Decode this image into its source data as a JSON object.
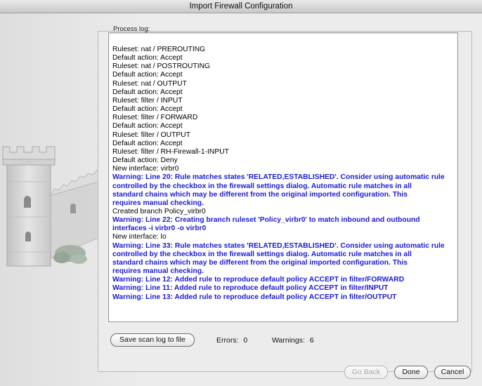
{
  "window": {
    "title": "Import Firewall Configuration"
  },
  "panel": {
    "label": "Process log:"
  },
  "log_lines": [
    {
      "text": "Ruleset: nat / PREROUTING",
      "kind": "normal"
    },
    {
      "text": "Default action: Accept",
      "kind": "normal"
    },
    {
      "text": "Ruleset: nat / POSTROUTING",
      "kind": "normal"
    },
    {
      "text": "Default action: Accept",
      "kind": "normal"
    },
    {
      "text": "Ruleset: nat / OUTPUT",
      "kind": "normal"
    },
    {
      "text": "Default action: Accept",
      "kind": "normal"
    },
    {
      "text": "Ruleset: filter / INPUT",
      "kind": "normal"
    },
    {
      "text": "Default action: Accept",
      "kind": "normal"
    },
    {
      "text": "Ruleset: filter / FORWARD",
      "kind": "normal"
    },
    {
      "text": "Default action: Accept",
      "kind": "normal"
    },
    {
      "text": "Ruleset: filter / OUTPUT",
      "kind": "normal"
    },
    {
      "text": "Default action: Accept",
      "kind": "normal"
    },
    {
      "text": "Ruleset: filter / RH-Firewall-1-INPUT",
      "kind": "normal"
    },
    {
      "text": "Default action: Deny",
      "kind": "normal"
    },
    {
      "text": "New interface: virbr0",
      "kind": "normal"
    },
    {
      "text": "Warning: Line 20: Rule matches states 'RELATED,ESTABLISHED'. Consider using automatic rule",
      "kind": "warning"
    },
    {
      "text": "controlled by the checkbox in the firewall settings dialog. Automatic rule matches in all",
      "kind": "warning"
    },
    {
      "text": "standard chains which may be different from the original imported configuration. This",
      "kind": "warning"
    },
    {
      "text": "requires manual checking.",
      "kind": "warning"
    },
    {
      "text": "Created branch Policy_virbr0",
      "kind": "normal"
    },
    {
      "text": "Warning: Line 22: Creating branch ruleset 'Policy_virbr0' to match inbound and outbound",
      "kind": "warning"
    },
    {
      "text": "interfaces -i virbr0 -o virbr0",
      "kind": "warning"
    },
    {
      "text": "New interface: lo",
      "kind": "normal"
    },
    {
      "text": "Warning: Line 33: Rule matches states 'RELATED,ESTABLISHED'. Consider using automatic rule",
      "kind": "warning"
    },
    {
      "text": "controlled by the checkbox in the firewall settings dialog. Automatic rule matches in all",
      "kind": "warning"
    },
    {
      "text": "standard chains which may be different from the original imported configuration. This",
      "kind": "warning"
    },
    {
      "text": "requires manual checking.",
      "kind": "warning"
    },
    {
      "text": "Warning: Line 12: Added rule to reproduce default policy ACCEPT in filter/FORWARD",
      "kind": "warning"
    },
    {
      "text": "Warning: Line 11: Added rule to reproduce default policy ACCEPT in filter/INPUT",
      "kind": "warning"
    },
    {
      "text": "Warning: Line 13: Added rule to reproduce default policy ACCEPT in filter/OUTPUT",
      "kind": "warning"
    }
  ],
  "status": {
    "save_button_label": "Save scan log to file",
    "errors_label": "Errors:",
    "errors_count": "0",
    "warnings_label": "Warnings:",
    "warnings_count": "6"
  },
  "footer": {
    "back_label": "Go Back",
    "back_enabled": false,
    "done_label": "Done",
    "cancel_label": "Cancel"
  },
  "colors": {
    "warning_text": "#1a1ad8",
    "normal_text": "#000000"
  },
  "icons": {
    "background_art": "castle-tower-icon"
  }
}
